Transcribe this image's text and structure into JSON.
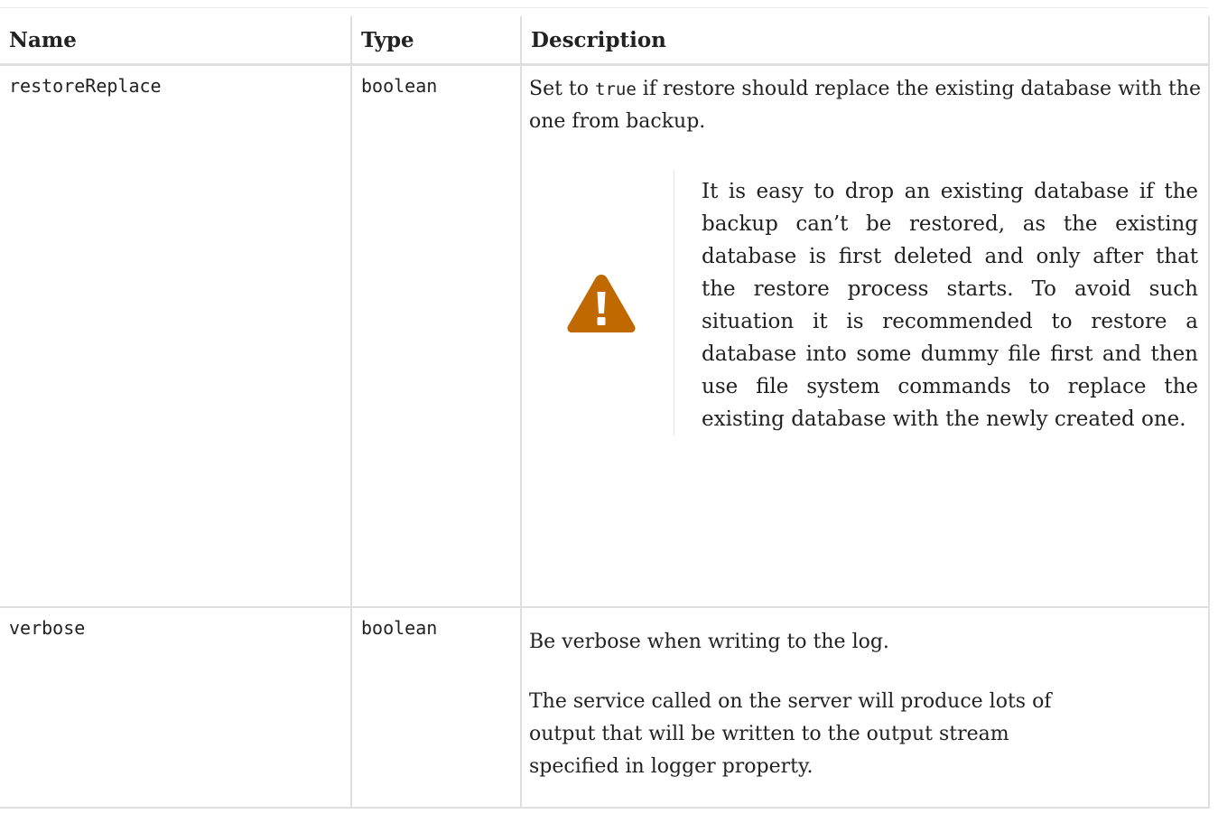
{
  "table": {
    "headers": {
      "name": "Name",
      "type": "Type",
      "description": "Description"
    },
    "rows": [
      {
        "name": "restoreReplace",
        "type": "boolean",
        "description": {
          "text_before": "Set to ",
          "code": "true",
          "text_after": " if restore should replace the existing database with the one from backup."
        },
        "warning": {
          "icon": "warning-icon",
          "icon_color": "#bf6900",
          "text": "It is easy to drop an existing database if the backup can’t be restored, as the existing database is first deleted and only after that the restore process starts. To avoid such situation it is recommended to restore a database into some dummy file first and then use file system commands to replace the existing database with the newly created one."
        }
      },
      {
        "name": "verbose",
        "type": "boolean",
        "description": {
          "paragraph_1": "Be verbose when writing to the log.",
          "paragraph_2": "The service called on the server will produce lots of output that will be written to the output stream specified in logger property."
        }
      }
    ]
  }
}
